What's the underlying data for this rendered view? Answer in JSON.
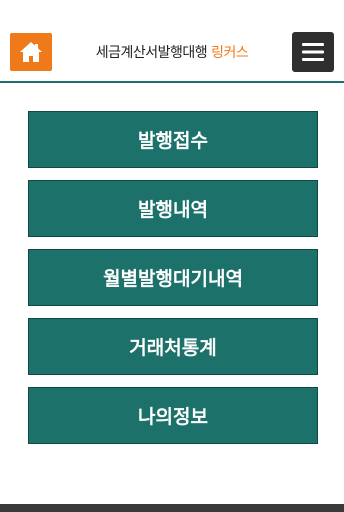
{
  "header": {
    "title": "세금계산서발행대행",
    "brand": "링커스",
    "home_icon": "home-icon",
    "menu_icon": "hamburger-menu-icon",
    "accent_color": "#f07a1a",
    "theme_color": "#1c726b"
  },
  "menu": {
    "items": [
      {
        "label": "발행접수"
      },
      {
        "label": "발행내역"
      },
      {
        "label": "월별발행대기내역"
      },
      {
        "label": "거래처통계"
      },
      {
        "label": "나의정보"
      }
    ]
  }
}
